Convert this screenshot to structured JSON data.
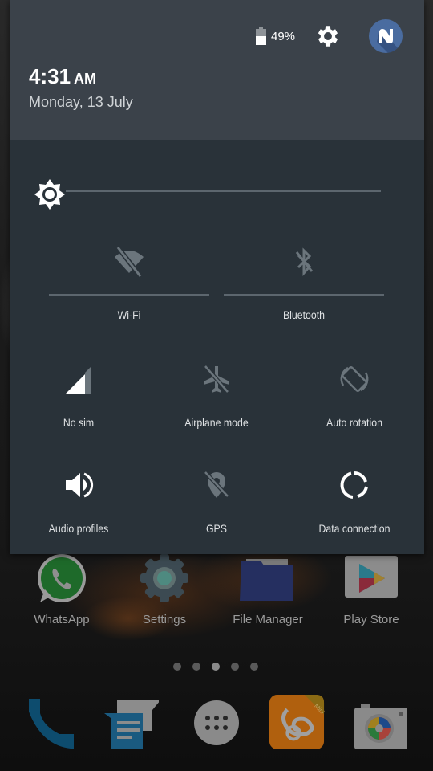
{
  "status": {
    "battery_percent": "49%",
    "battery_level": 0.49
  },
  "header": {
    "time": "4:31",
    "ampm": "AM",
    "date": "Monday, 13 July",
    "settings_icon": "gear-icon",
    "avatar_icon": "n-logo-avatar-icon"
  },
  "brightness": {
    "level": 0.0,
    "icon": "brightness-icon"
  },
  "tiles": [
    {
      "label": "Wi-Fi",
      "icon": "wifi-off-icon",
      "state": "off"
    },
    {
      "label": "Bluetooth",
      "icon": "bluetooth-off-icon",
      "state": "off"
    },
    {
      "label": "No sim",
      "icon": "signal-icon",
      "state": "on"
    },
    {
      "label": "Airplane mode",
      "icon": "airplane-off-icon",
      "state": "off"
    },
    {
      "label": "Auto rotation",
      "icon": "rotation-icon",
      "state": "off"
    },
    {
      "label": "Audio profiles",
      "icon": "speaker-icon",
      "state": "on"
    },
    {
      "label": "GPS",
      "icon": "gps-off-icon",
      "state": "off"
    },
    {
      "label": "Data connection",
      "icon": "data-connection-icon",
      "state": "on"
    }
  ],
  "home": {
    "apps": [
      {
        "label": "WhatsApp",
        "icon": "whatsapp-icon"
      },
      {
        "label": "Settings",
        "icon": "settings-app-icon"
      },
      {
        "label": "File Manager",
        "icon": "folder-icon"
      },
      {
        "label": "Play Store",
        "icon": "play-store-icon"
      }
    ],
    "page_count": 5,
    "active_page": 3,
    "dock": [
      {
        "name": "Phone",
        "icon": "phone-icon"
      },
      {
        "name": "Messaging",
        "icon": "messaging-icon"
      },
      {
        "name": "App drawer",
        "icon": "app-drawer-icon"
      },
      {
        "name": "UC Browser Mini",
        "icon": "uc-browser-icon",
        "badge": "Mini"
      },
      {
        "name": "Camera",
        "icon": "camera-icon"
      }
    ]
  },
  "colors": {
    "header_bg": "#3b424a",
    "panel_bg": "#293239",
    "icon_on": "#ffffff",
    "icon_off": "#6b757c",
    "avatar_bg": "#4a6ca0"
  }
}
